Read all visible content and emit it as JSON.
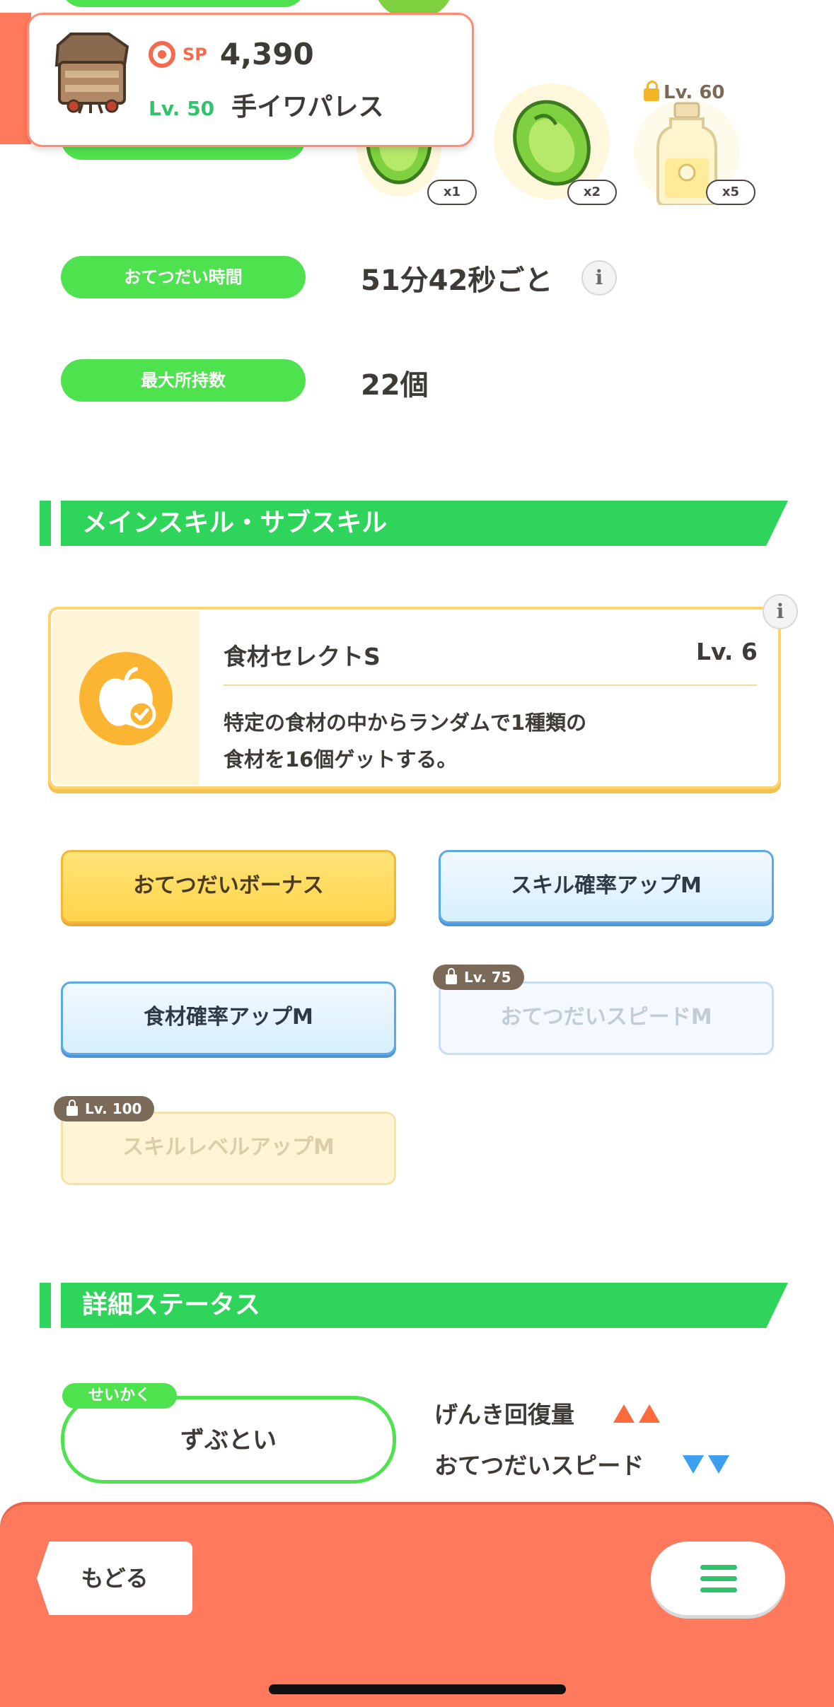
{
  "header": {
    "sp_label": "SP",
    "sp_value": "4,390",
    "level": "Lv. 50",
    "name": "手イワパレス"
  },
  "ingredients": {
    "items": [
      {
        "icon": "avocado-icon",
        "count": "x1"
      },
      {
        "icon": "avocado-icon",
        "count": "x2"
      },
      {
        "icon": "oil-bottle-icon",
        "count": "x5",
        "lock": "Lv. 60"
      }
    ]
  },
  "stats": {
    "help_time": {
      "label": "おてつだい時間",
      "value": "51分42秒ごと"
    },
    "max_carry": {
      "label": "最大所持数",
      "value": "22個"
    }
  },
  "skills_section": {
    "title": "メインスキル・サブスキル",
    "main_skill": {
      "name": "食材セレクトS",
      "level": "Lv. 6",
      "description": "特定の食材の中からランダムで1種類の\n食材を16個ゲットする。",
      "icon": "apple-check-icon"
    },
    "sub_skills": [
      {
        "label": "おてつだいボーナス",
        "style": "gold",
        "lock": ""
      },
      {
        "label": "スキル確率アップM",
        "style": "blue",
        "lock": ""
      },
      {
        "label": "食材確率アップM",
        "style": "blue",
        "lock": ""
      },
      {
        "label": "おてつだいスピードM",
        "style": "blue-locked",
        "lock": "Lv. 75"
      },
      {
        "label": "スキルレベルアップM",
        "style": "gold-locked",
        "lock": "Lv. 100"
      }
    ]
  },
  "detail_section": {
    "title": "詳細ステータス",
    "nature_tag": "せいかく",
    "nature": "ずぶとい",
    "effects": [
      {
        "label": "げんき回復量",
        "direction": "up"
      },
      {
        "label": "おてつだいスピード",
        "direction": "down"
      }
    ]
  },
  "bottom_bar": {
    "back_label": "もどる",
    "menu_icon": "hamburger-menu-icon"
  },
  "colors": {
    "accent_green": "#4fe24f",
    "accent_coral": "#ff7a5c",
    "gold": "#ffd44a",
    "blue": "#5aa8e6"
  }
}
